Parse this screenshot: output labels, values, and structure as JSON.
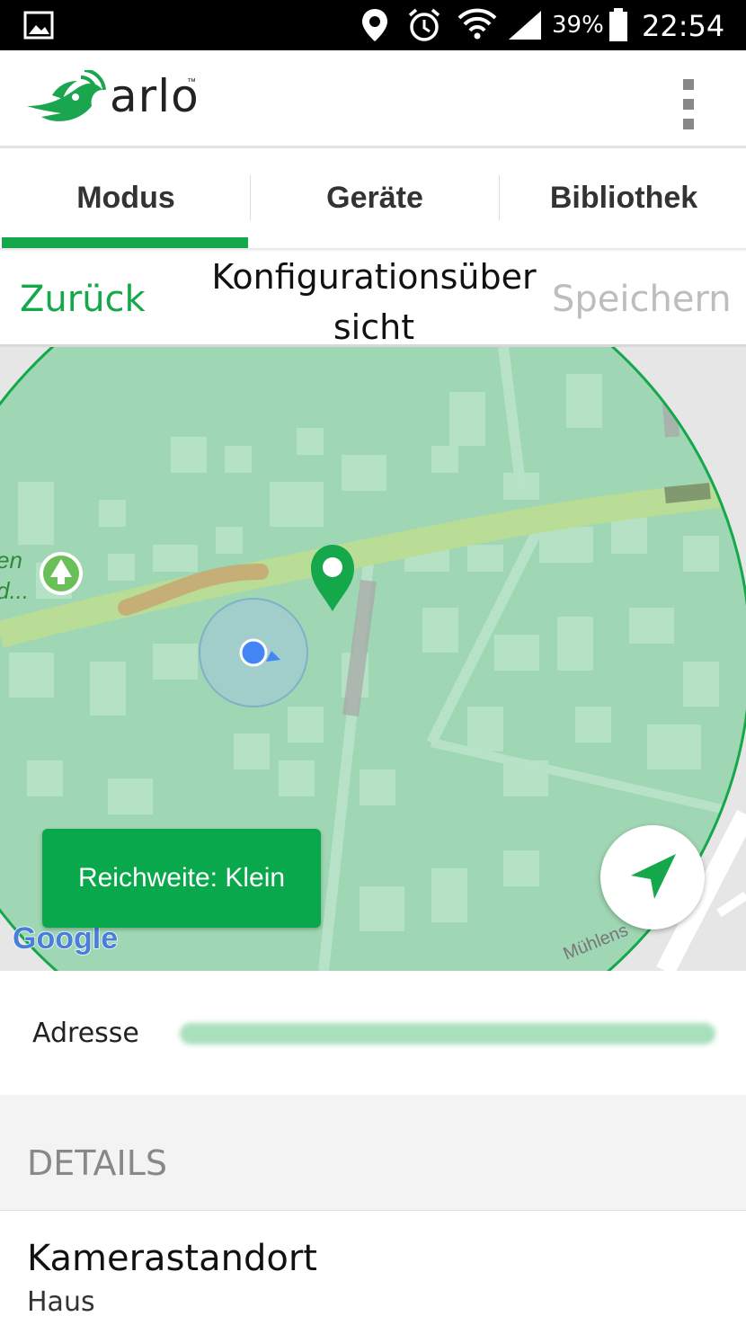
{
  "status_bar": {
    "battery_percent": "39%",
    "time": "22:54",
    "icons": [
      "gallery-icon",
      "location-icon",
      "alarm-icon",
      "wifi-icon",
      "signal-icon",
      "battery-icon"
    ]
  },
  "app": {
    "brand": "arlo",
    "trademark": "™",
    "menu_icon": "more-vert-icon"
  },
  "tabs": [
    {
      "label": "Modus",
      "active": true
    },
    {
      "label": "Geräte",
      "active": false
    },
    {
      "label": "Bibliothek",
      "active": false
    }
  ],
  "nav": {
    "back_label": "Zurück",
    "title": "Konfigurationsübersicht",
    "save_label": "Speichern"
  },
  "map": {
    "poi_label_line1": "en",
    "poi_label_line2": "d...",
    "street_label": "Mühlens",
    "attribution": "Google",
    "range_button_label": "Reichweite: Klein",
    "locate_icon": "navigation-arrow-icon"
  },
  "address": {
    "label": "Adresse"
  },
  "details": {
    "section_title": "DETAILS",
    "camera_location_title": "Kamerastandort",
    "camera_location_value": "Haus"
  },
  "colors": {
    "accent": "#14a84a",
    "button_green": "#0aa84c",
    "geofence_fill": "#9fd6b3",
    "disabled_text": "#bdbdbd"
  }
}
